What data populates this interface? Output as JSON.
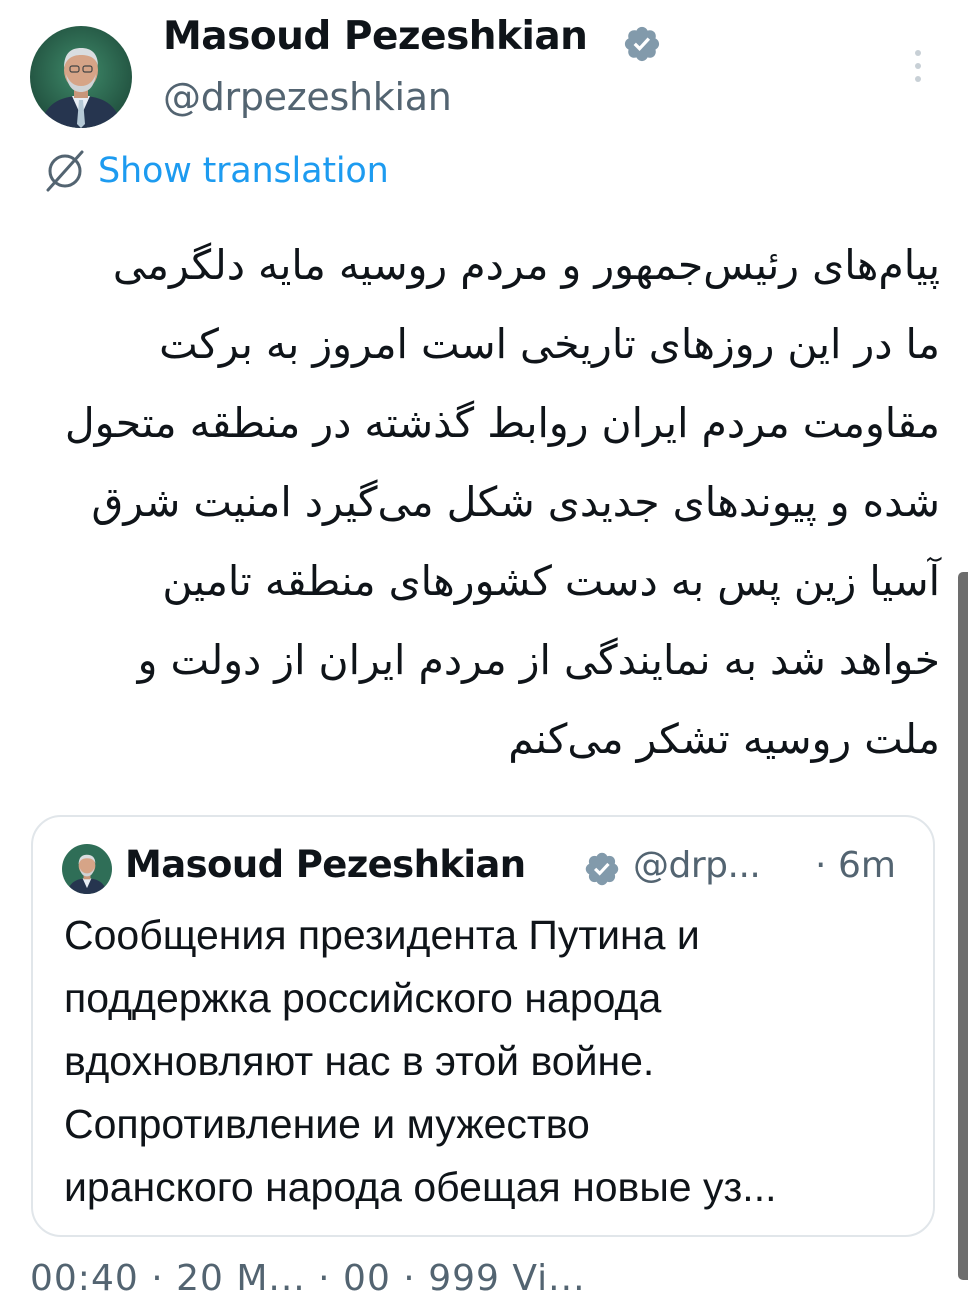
{
  "author": {
    "display_name": "Masoud Pezeshkian",
    "handle": "@drpezeshkian",
    "verified": true,
    "avatar_icon": "person-portrait-icon"
  },
  "translate": {
    "label": "Show translation",
    "icon": "globe-translate-icon"
  },
  "menu": {
    "icon": "vertical-ellipsis-icon"
  },
  "tweet": {
    "lines": [
      "پیام‌های رئیس‌جمهور و مردم روسیه مایه دلگرمی",
      "ما در این روزهای تاریخی است امروز به برکت",
      "مقاومت مردم ایران روابط گذشته در منطقه متحول",
      "شده و پیوندهای جدیدی شکل می‌گیرد امنیت شرق",
      "آسیا زین پس به دست کشورهای منطقه تامین",
      "خواهد شد به نمایندگی از مردم ایران از دولت و",
      "ملت روسیه تشکر می‌کنم"
    ]
  },
  "quote": {
    "display_name": "Masoud Pezeshkian",
    "handle": "@drp...",
    "separator": "·",
    "time": "6m",
    "lines": [
      "Сообщения президента Путина и",
      "поддержка российского народа",
      "вдохновляют нас в этой войне.",
      "Сопротивление и мужество",
      "иранского народа обещая новые уз..."
    ]
  },
  "footer": {
    "partial_text": "00:40 · 20 M... · 00 · 999 Vi..."
  },
  "colors": {
    "text": "#0f1419",
    "secondary": "#536471",
    "link": "#1d9bf0",
    "verified_badge": "#829aab",
    "border": "#e1e6ea"
  }
}
